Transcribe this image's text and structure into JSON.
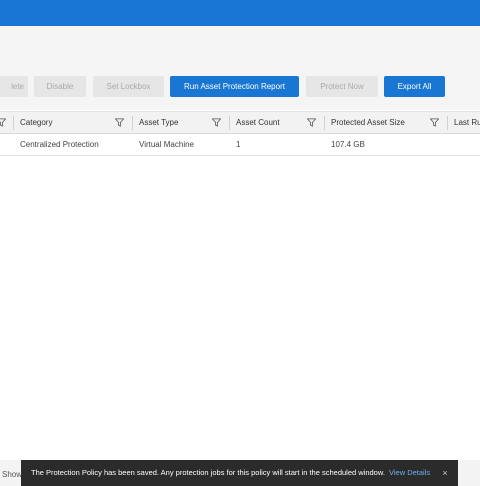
{
  "colors": {
    "brand": "#1976d2",
    "toast_bg": "#2b2b2b",
    "link": "#6fb2f2"
  },
  "toolbar": {
    "delete_label": "lete",
    "disable_label": "Disable",
    "set_lockbox_label": "Set Lockbox",
    "run_report_label": "Run Asset Protection Report",
    "protect_now_label": "Protect Now",
    "export_all_label": "Export All"
  },
  "table": {
    "columns": [
      "Category",
      "Asset Type",
      "Asset Count",
      "Protected Asset Size",
      "Last Ru"
    ],
    "rows": [
      {
        "category": "Centralized Protection",
        "asset_type": "Virtual Machine",
        "asset_count": "1",
        "protected_size": "107.4 GB"
      }
    ]
  },
  "footer": {
    "show_label": "Show"
  },
  "toast": {
    "message": "The Protection Policy has been saved. Any protection jobs for this policy will start in the scheduled window.",
    "link_label": "View Details",
    "close_glyph": "×",
    "icons": [
      "filter-icon",
      "close-icon"
    ]
  }
}
